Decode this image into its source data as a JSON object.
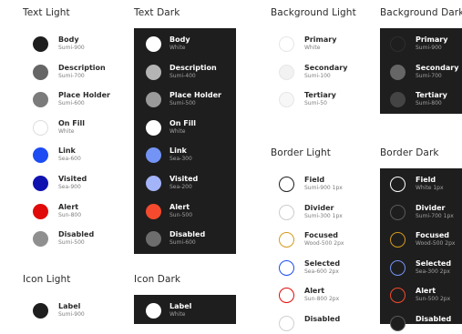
{
  "sections": [
    {
      "key": "text_light",
      "title": "Text Light",
      "theme": "light",
      "items": [
        {
          "name": "Body",
          "token": "Sumi-900",
          "color": "#1e1e1e",
          "border": ""
        },
        {
          "name": "Description",
          "token": "Sumi-700",
          "color": "#666666",
          "border": ""
        },
        {
          "name": "Place Holder",
          "token": "Sumi-600",
          "color": "#7b7b7b",
          "border": ""
        },
        {
          "name": "On Fill",
          "token": "White",
          "color": "#ffffff",
          "border": "#dddddd"
        },
        {
          "name": "Link",
          "token": "Sea-600",
          "color": "#1d4cf2",
          "border": ""
        },
        {
          "name": "Visited",
          "token": "Sea-900",
          "color": "#1012b0",
          "border": ""
        },
        {
          "name": "Alert",
          "token": "Sun-800",
          "color": "#e00a0a",
          "border": ""
        },
        {
          "name": "Disabled",
          "token": "Sumi-500",
          "color": "#8f8f8f",
          "border": ""
        }
      ]
    },
    {
      "key": "text_dark",
      "title": "Text Dark",
      "theme": "dark",
      "items": [
        {
          "name": "Body",
          "token": "White",
          "color": "#ffffff",
          "border": ""
        },
        {
          "name": "Description",
          "token": "Sumi-400",
          "color": "#b4b4b4",
          "border": ""
        },
        {
          "name": "Place Holder",
          "token": "Sumi-500",
          "color": "#9a9a9a",
          "border": ""
        },
        {
          "name": "On Fill",
          "token": "White",
          "color": "#ffffff",
          "border": ""
        },
        {
          "name": "Link",
          "token": "Sea-300",
          "color": "#7393f5",
          "border": ""
        },
        {
          "name": "Visited",
          "token": "Sea-200",
          "color": "#a4b4f8",
          "border": ""
        },
        {
          "name": "Alert",
          "token": "Sun-500",
          "color": "#f54a2d",
          "border": ""
        },
        {
          "name": "Disabled",
          "token": "Sumi-600",
          "color": "#6d6d6d",
          "border": ""
        }
      ]
    },
    {
      "key": "background_light",
      "title": "Background Light",
      "theme": "light",
      "items": [
        {
          "name": "Primary",
          "token": "White",
          "color": "#ffffff",
          "border": "#e6e6e6"
        },
        {
          "name": "Secondary",
          "token": "Sumi-100",
          "color": "#f2f2f2",
          "border": "#e6e6e6"
        },
        {
          "name": "Tertiary",
          "token": "Sumi-50",
          "color": "#f7f7f7",
          "border": "#e6e6e6"
        }
      ]
    },
    {
      "key": "background_dark",
      "title": "Background Dark",
      "theme": "dark",
      "items": [
        {
          "name": "Primary",
          "token": "Sumi-900",
          "color": "#1e1e1e",
          "border": "#2e2e2e"
        },
        {
          "name": "Secondary",
          "token": "Sumi-700",
          "color": "#666666",
          "border": ""
        },
        {
          "name": "Tertiary",
          "token": "Sumi-800",
          "color": "#444444",
          "border": ""
        }
      ]
    },
    {
      "key": "border_light",
      "title": "Border Light",
      "theme": "light",
      "items": [
        {
          "name": "Field",
          "token": "Sumi-900 1px",
          "color": "#ffffff",
          "border": "#1e1e1e"
        },
        {
          "name": "Divider",
          "token": "Sumi-300 1px",
          "color": "#ffffff",
          "border": "#cccccc"
        },
        {
          "name": "Focused",
          "token": "Wood-500 2px",
          "color": "#ffffff",
          "border": "#d49a1c"
        },
        {
          "name": "Selected",
          "token": "Sea-600 2px",
          "color": "#ffffff",
          "border": "#1d4cf2"
        },
        {
          "name": "Alert",
          "token": "Sun-800 2px",
          "color": "#ffffff",
          "border": "#e00a0a"
        },
        {
          "name": "Disabled",
          "token": "",
          "color": "#ffffff",
          "border": "#cfcfcf"
        }
      ]
    },
    {
      "key": "border_dark",
      "title": "Border Dark",
      "theme": "dark",
      "items": [
        {
          "name": "Field",
          "token": "White 1px",
          "color": "#1e1e1e",
          "border": "#ffffff"
        },
        {
          "name": "Divider",
          "token": "Sumi-700 1px",
          "color": "#1e1e1e",
          "border": "#5a5a5a"
        },
        {
          "name": "Focused",
          "token": "Wood-500 2px",
          "color": "#1e1e1e",
          "border": "#d49a1c"
        },
        {
          "name": "Selected",
          "token": "Sea-300 2px",
          "color": "#1e1e1e",
          "border": "#7393f5"
        },
        {
          "name": "Alert",
          "token": "Sun-500 2px",
          "color": "#1e1e1e",
          "border": "#f54a2d"
        },
        {
          "name": "Disabled",
          "token": "",
          "color": "#1e1e1e",
          "border": "#5a5a5a"
        }
      ]
    },
    {
      "key": "icon_light",
      "title": "Icon Light",
      "theme": "light",
      "items": [
        {
          "name": "Label",
          "token": "Sumi-900",
          "color": "#1e1e1e",
          "border": ""
        }
      ]
    },
    {
      "key": "icon_dark",
      "title": "Icon Dark",
      "theme": "dark",
      "items": [
        {
          "name": "Label",
          "token": "White",
          "color": "#ffffff",
          "border": ""
        }
      ]
    }
  ]
}
